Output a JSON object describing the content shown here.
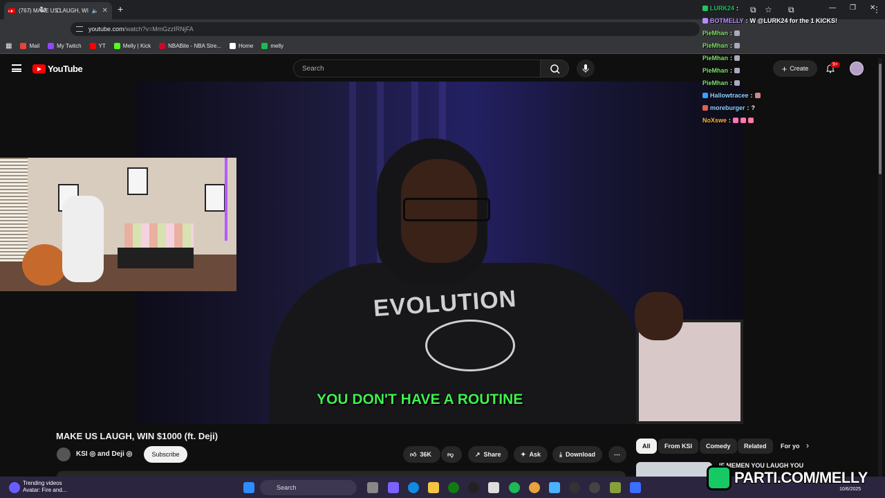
{
  "browser": {
    "tab_title": "(767) MAKE US LAUGH, WI",
    "url_host": "youtube.com",
    "url_path": "/watch?v=MmGzzIRNjFA",
    "bookmarks": [
      {
        "label": "Mail",
        "color": "#ea4335"
      },
      {
        "label": "My Twitch",
        "color": "#9146ff"
      },
      {
        "label": "YT",
        "color": "#ff0000"
      },
      {
        "label": "Melly | Kick",
        "color": "#53fc18"
      },
      {
        "label": "NBABite - NBA Stre...",
        "color": "#c9082a"
      },
      {
        "label": "Home",
        "color": "#ffffff"
      },
      {
        "label": "melly",
        "color": "#1db954"
      }
    ]
  },
  "youtube": {
    "logo_text": "YouTube",
    "search_placeholder": "Search",
    "create_label": "Create",
    "notif_badge": "9+",
    "video": {
      "subtitle": "YOU DON'T HAVE A ROUTINE",
      "hoodie_text": "EVOLUTION",
      "title": "MAKE US LAUGH, WIN $1000 (ft. Deji)",
      "channel": "KSI ◎ and Deji ◎",
      "subscribe": "Subscribe",
      "likes": "36K",
      "share": "Share",
      "ask": "Ask",
      "download": "Download"
    },
    "chips": [
      "All",
      "From KSI",
      "Comedy",
      "Related",
      "For yo"
    ],
    "rec_title": "IF MEMEN YOU LAUGH YOU"
  },
  "chat": [
    {
      "user": "LURK24",
      "msg": "",
      "color": "#22c55e"
    },
    {
      "user": "BOTMELLY",
      "msg": "W @LURK24 for the 1 KICKS!",
      "color": "#b78cff"
    },
    {
      "user": "PieMhan",
      "msg": "",
      "color": "#7ee06b"
    },
    {
      "user": "PieMhan",
      "msg": "",
      "color": "#7ee06b"
    },
    {
      "user": "PieMhan",
      "msg": "",
      "color": "#7ee06b"
    },
    {
      "user": "PieMhan",
      "msg": "",
      "color": "#7ee06b"
    },
    {
      "user": "PieMhan",
      "msg": "",
      "color": "#7ee06b"
    },
    {
      "user": "Hallowtracee",
      "msg": "",
      "color": "#8fd3ff"
    },
    {
      "user": "moreburger",
      "msg": "?",
      "color": "#8fd3ff"
    },
    {
      "user": "NoXswe",
      "msg": "",
      "color": "#ffb347"
    }
  ],
  "taskbar": {
    "trend_title": "Trending videos",
    "trend_sub": "Avatar: Fire and...",
    "search": "Search",
    "date": "10/6/2025"
  },
  "watermark": "PARTI.COM/MELLY"
}
